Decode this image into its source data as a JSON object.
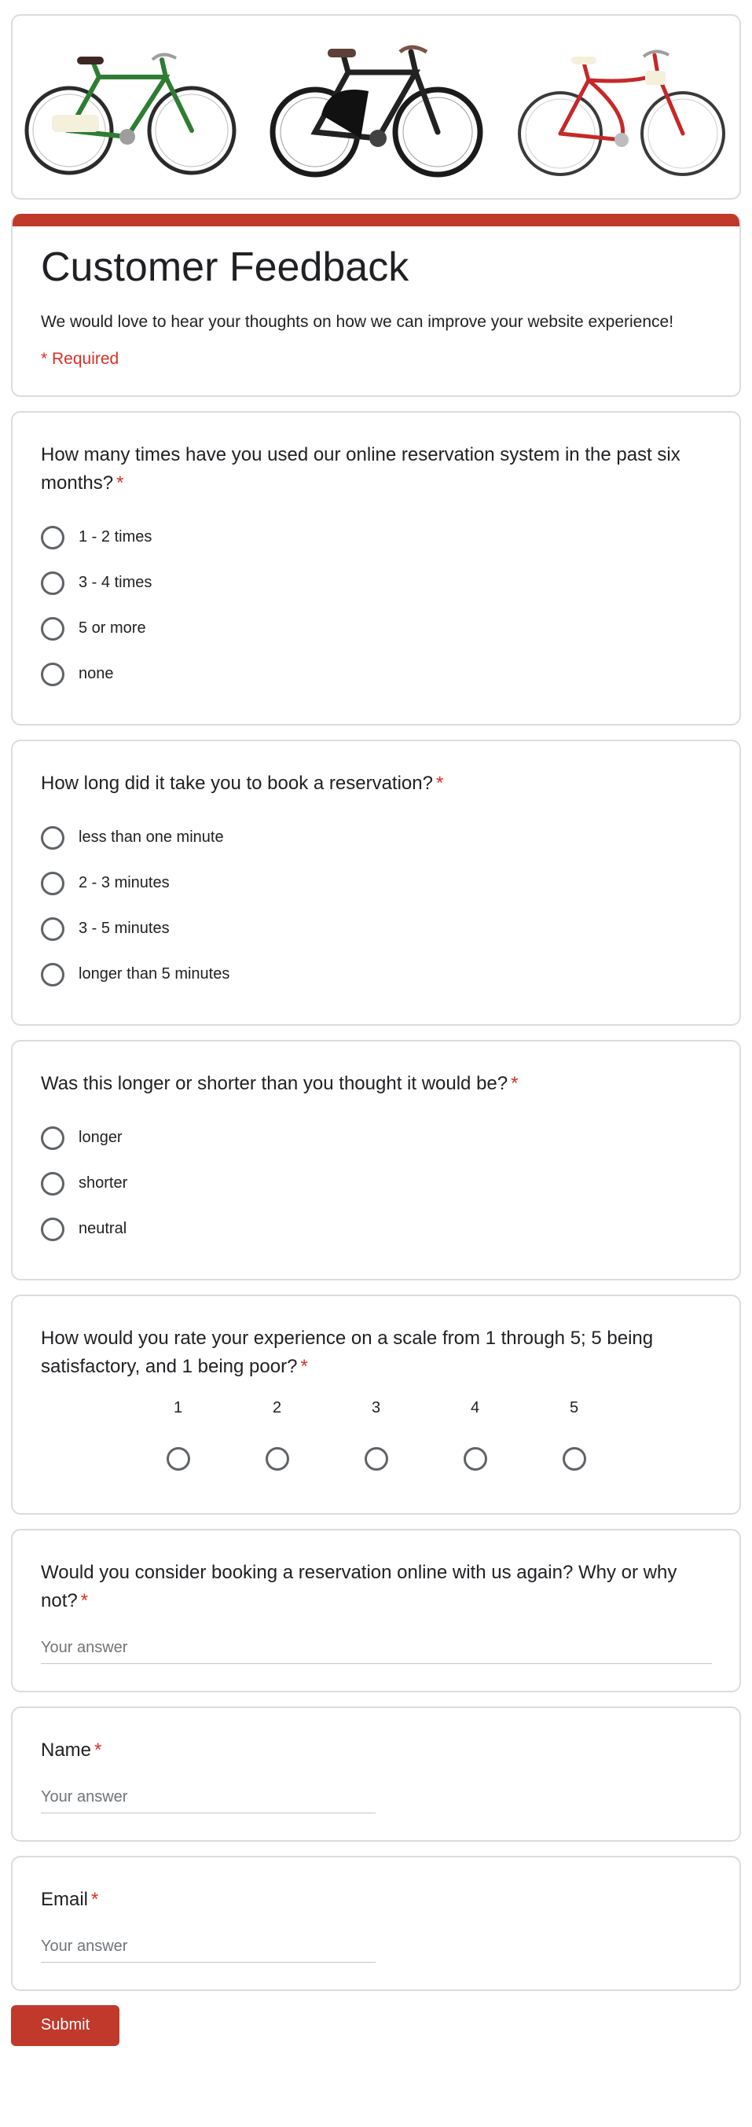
{
  "form": {
    "title": "Customer Feedback",
    "description": "We would love to hear your thoughts on how we can improve your website experience!",
    "required_note": "* Required",
    "accent_color": "#c0392b",
    "required_color": "#d93025"
  },
  "banner": {
    "images": [
      {
        "icon": "bicycle-green-icon",
        "color": "#2e7d32"
      },
      {
        "icon": "bicycle-black-icon",
        "color": "#222222"
      },
      {
        "icon": "bicycle-red-icon",
        "color": "#c62828"
      }
    ]
  },
  "q1": {
    "title": "How many times have you used our online reservation system in the past six months?",
    "star": "*",
    "options": [
      "1 - 2 times",
      "3 - 4 times",
      "5 or more",
      "none"
    ]
  },
  "q2": {
    "title": "How long did it take you to book a reservation?",
    "star": "*",
    "options": [
      "less than one minute",
      "2 - 3 minutes",
      "3 - 5 minutes",
      "longer than 5 minutes"
    ]
  },
  "q3": {
    "title": "Was this longer or shorter than you thought it would be?",
    "star": "*",
    "options": [
      "longer",
      "shorter",
      "neutral"
    ]
  },
  "q4": {
    "title": "How would you rate your experience on a scale from 1 through 5; 5 being satisfactory, and 1 being poor?",
    "star": "*",
    "scale": [
      "1",
      "2",
      "3",
      "4",
      "5"
    ]
  },
  "q5": {
    "title": "Would you consider booking a reservation online with us again? Why or why not?",
    "star": "*",
    "placeholder": "Your answer"
  },
  "q6": {
    "title": "Name",
    "star": "*",
    "placeholder": "Your answer"
  },
  "q7": {
    "title": "Email",
    "star": "*",
    "placeholder": "Your answer"
  },
  "submit": {
    "label": "Submit"
  }
}
